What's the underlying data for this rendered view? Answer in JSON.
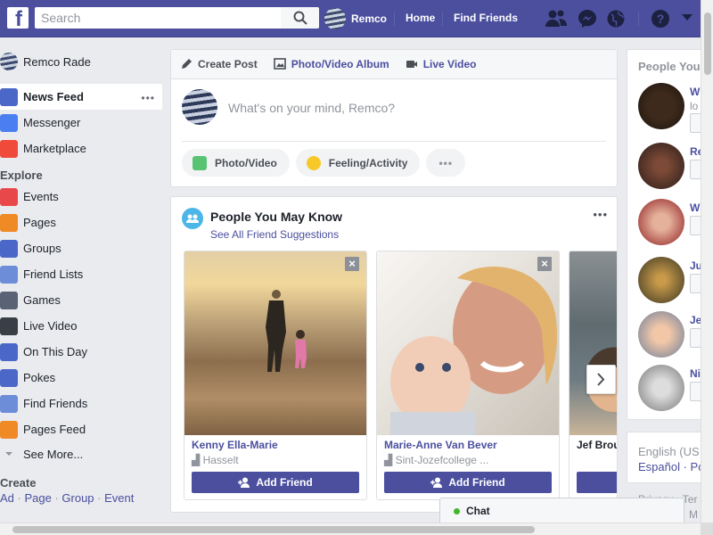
{
  "topbar": {
    "logo_letter": "f",
    "search_placeholder": "Search",
    "user_name": "Remco",
    "home_label": "Home",
    "find_friends_label": "Find Friends"
  },
  "left_nav": {
    "profile_name": "Remco Rade",
    "items": [
      {
        "label": "News Feed",
        "icon": "news-feed-icon",
        "color": "#4b67c8"
      },
      {
        "label": "Messenger",
        "icon": "messenger-icon",
        "color": "#4b7ef0"
      },
      {
        "label": "Marketplace",
        "icon": "marketplace-icon",
        "color": "#f04a3a"
      }
    ],
    "explore_heading": "Explore",
    "explore_items": [
      {
        "label": "Events",
        "icon": "calendar-icon",
        "color": "#e9484b"
      },
      {
        "label": "Pages",
        "icon": "flag-icon",
        "color": "#f08a24"
      },
      {
        "label": "Groups",
        "icon": "groups-icon",
        "color": "#4b67c8"
      },
      {
        "label": "Friend Lists",
        "icon": "friend-list-icon",
        "color": "#6d8dd8"
      },
      {
        "label": "Games",
        "icon": "games-icon",
        "color": "#5a6275"
      },
      {
        "label": "Live Video",
        "icon": "live-video-icon",
        "color": "#3a3f47"
      },
      {
        "label": "On This Day",
        "icon": "clock-icon",
        "color": "#4b67c8"
      },
      {
        "label": "Pokes",
        "icon": "poke-icon",
        "color": "#4b67c8"
      },
      {
        "label": "Find Friends",
        "icon": "find-friends-icon",
        "color": "#6d8dd8"
      },
      {
        "label": "Pages Feed",
        "icon": "pages-feed-icon",
        "color": "#f08a24"
      }
    ],
    "see_more": "See More...",
    "create_heading": "Create",
    "create_links": [
      "Ad",
      "Page",
      "Group",
      "Event"
    ]
  },
  "composer": {
    "tabs": [
      "Create Post",
      "Photo/Video Album",
      "Live Video"
    ],
    "placeholder": "What's on your mind, Remco?",
    "buttons": [
      "Photo/Video",
      "Feeling/Activity"
    ]
  },
  "pymk": {
    "title": "People You May Know",
    "see_all": "See All Friend Suggestions",
    "cards": [
      {
        "name": "Kenny Ella-Marie",
        "meta": "Hasselt",
        "button": "Add Friend"
      },
      {
        "name": "Marie-Anne Van Bever",
        "meta": "Sint-Jozefcollege ...",
        "button": "Add Friend"
      },
      {
        "name": "Jef Brou",
        "meta": "",
        "button": ""
      }
    ]
  },
  "right_rail": {
    "heading": "People You",
    "people": [
      {
        "name": "W",
        "sub": "lo"
      },
      {
        "name": "Re",
        "sub": ""
      },
      {
        "name": "W",
        "sub": ""
      },
      {
        "name": "Ju",
        "sub": ""
      },
      {
        "name": "Je",
        "sub": ""
      },
      {
        "name": "Ni",
        "sub": ""
      }
    ]
  },
  "languages": {
    "current": "English (US",
    "others": "Español · Po"
  },
  "footer_text": "Privacy · Ter",
  "footer_text2": "M",
  "chat": {
    "label": "Chat",
    "status_color": "#42b72a"
  }
}
